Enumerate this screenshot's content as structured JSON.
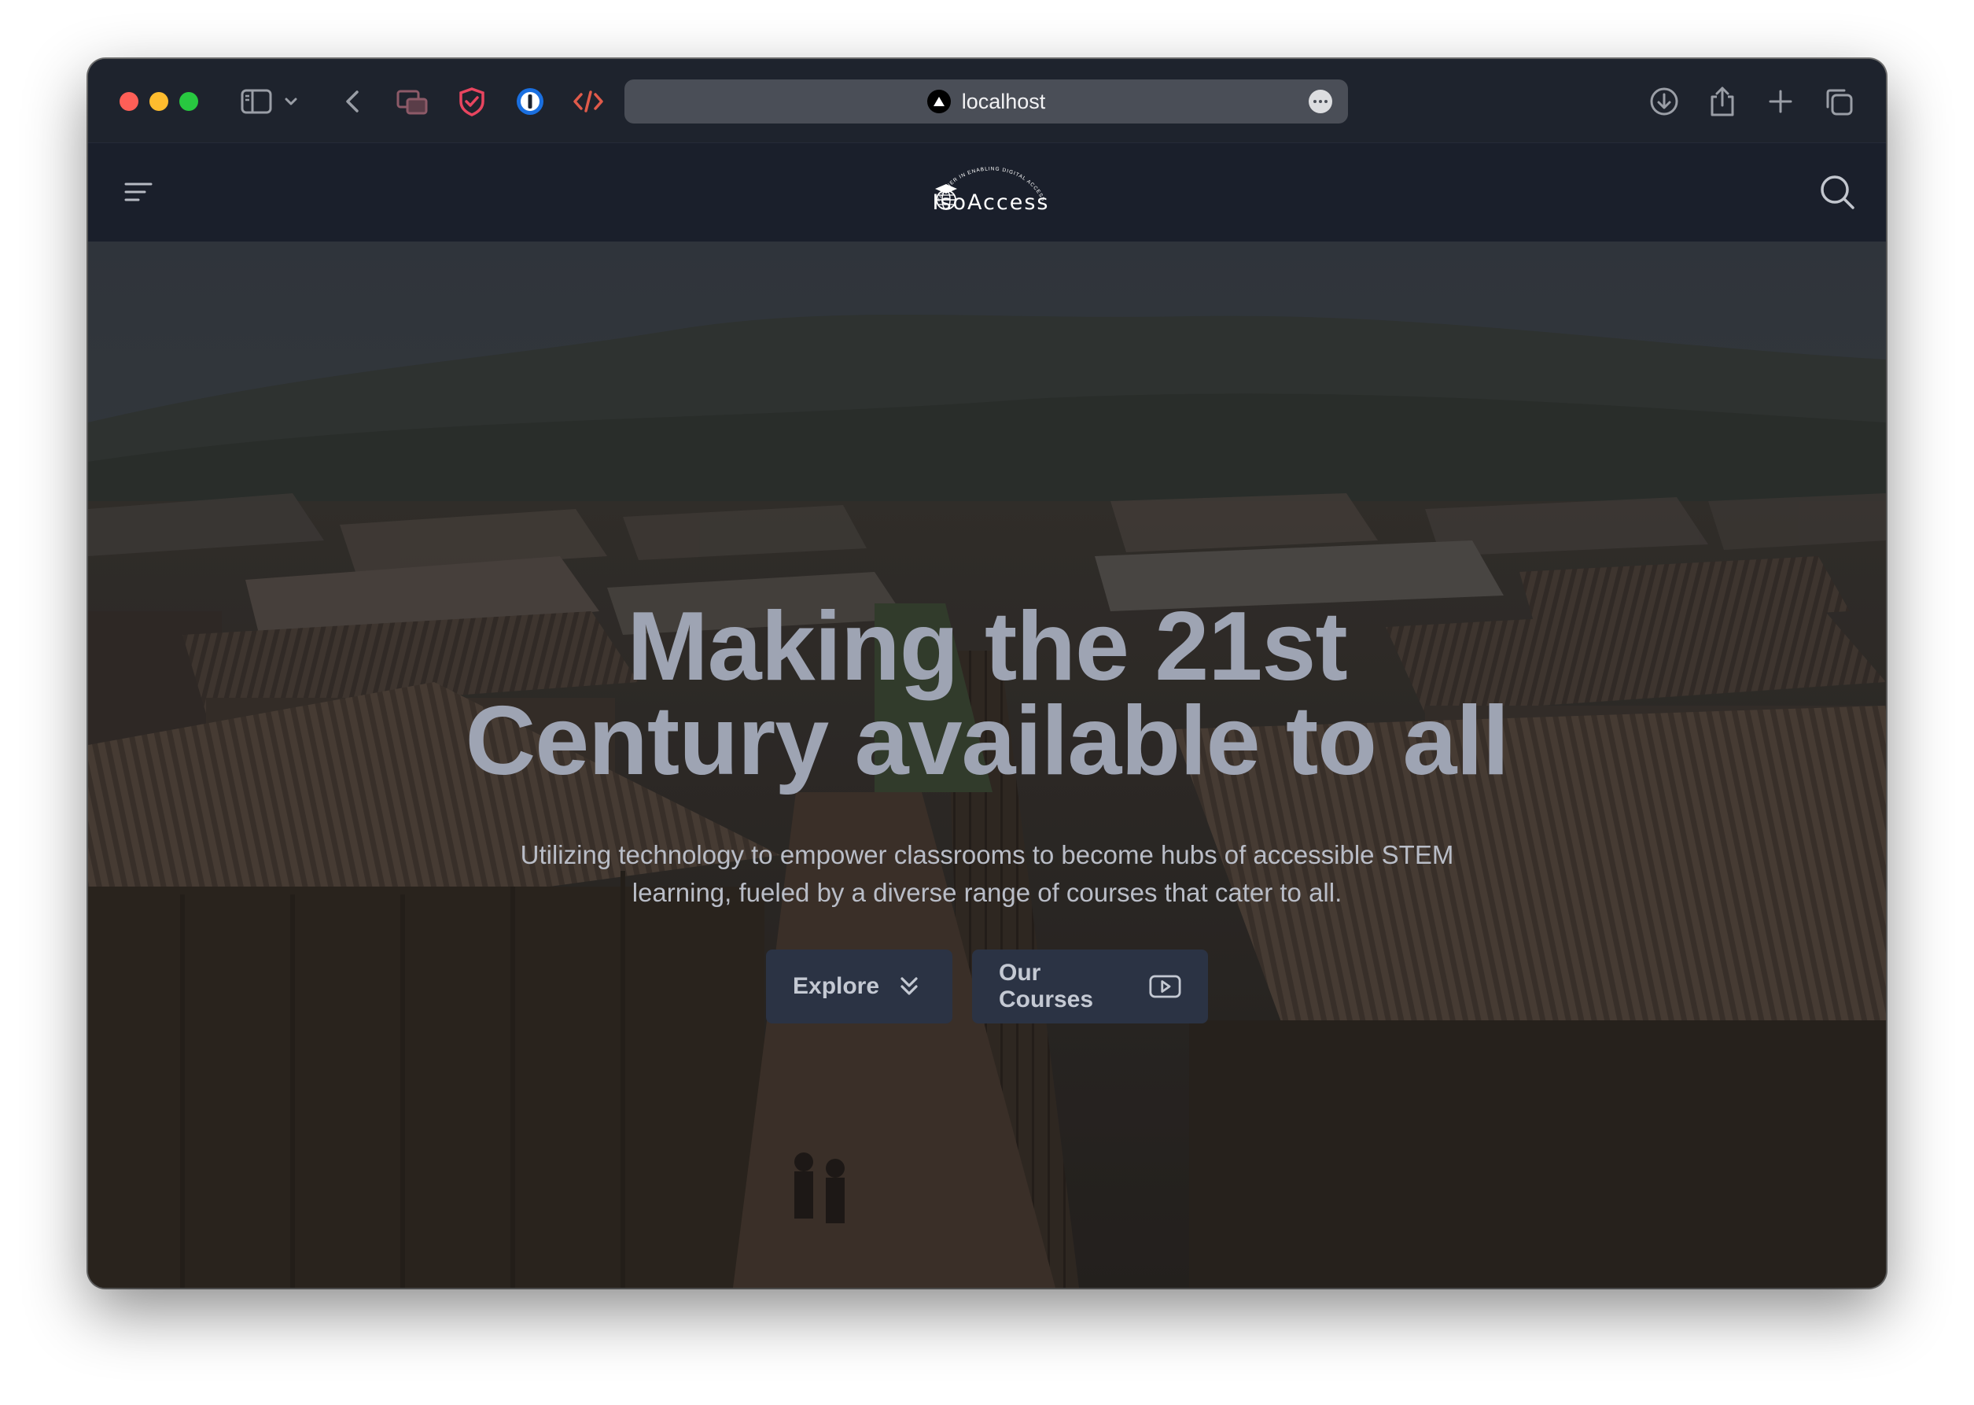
{
  "browser": {
    "url": "localhost",
    "buttons": [
      "sidebar",
      "tab-overview",
      "back",
      "picture-in-picture",
      "privacy-shield",
      "password-manager",
      "dev-tools",
      "downloads",
      "share",
      "new-tab",
      "tabs-overview"
    ]
  },
  "site": {
    "logo_text": "IsoAccess",
    "logo_arc_text": "PARTNER IN ENABLING DIGITAL ACCESS"
  },
  "hero": {
    "title_line1": "Making the 21st",
    "title_line2": "Century available to all",
    "subtitle_line1": "Utilizing technology to empower classrooms to become hubs of accessible STEM",
    "subtitle_line2": "learning, fueled by a diverse range of courses that cater to all.",
    "buttons": {
      "explore_label": "Explore",
      "explore_icon": "chevrons-down-icon",
      "courses_label": "Our Courses",
      "courses_icon": "play-icon"
    }
  },
  "colors": {
    "header_bg": "#1a1f2b",
    "hero_title": "#9ea4b3",
    "button_bg": "#2b3344"
  }
}
